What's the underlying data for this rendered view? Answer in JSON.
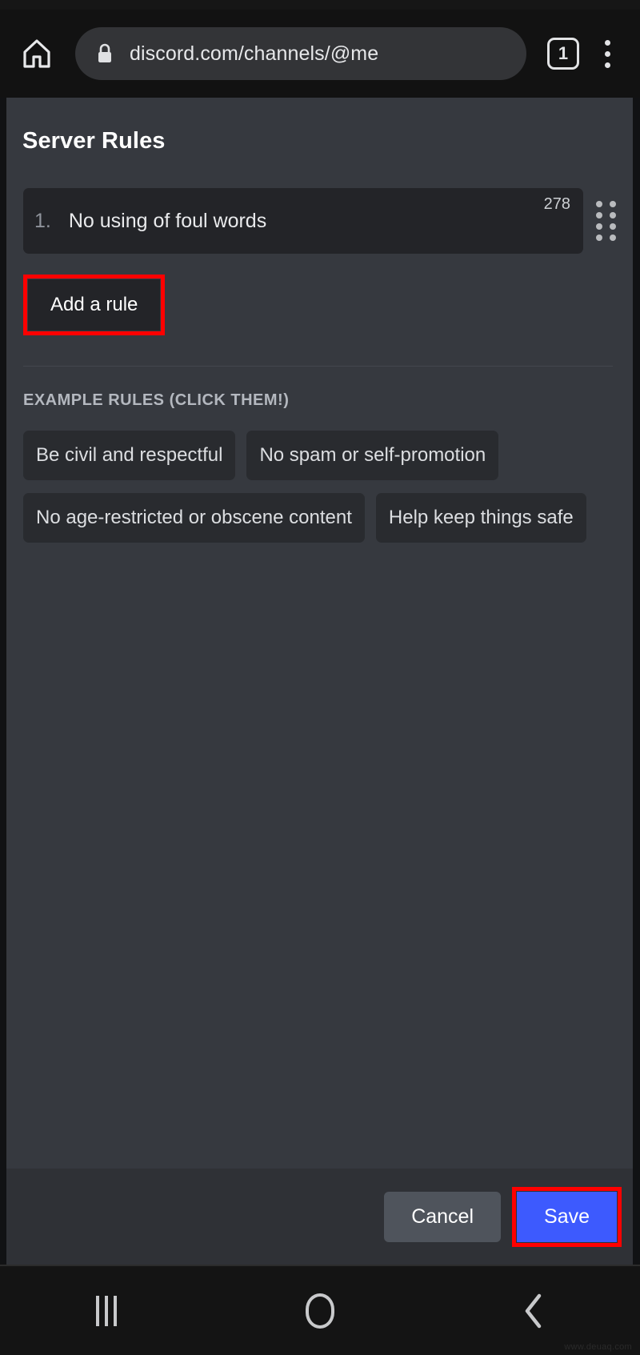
{
  "status_bar": {
    "left_text": "",
    "right_text": ""
  },
  "browser": {
    "home_icon": "home-icon",
    "lock_icon": "lock-icon",
    "url": "discord.com/channels/@me",
    "tab_count": "1",
    "menu_icon": "overflow-menu-icon"
  },
  "page": {
    "title": "Server Rules",
    "rule": {
      "number": "1.",
      "text": "No using of foul words",
      "char_count": "278",
      "drag_handle_icon": "drag-handle-icon"
    },
    "add_rule_label": "Add a rule",
    "examples_label": "EXAMPLE RULES (CLICK THEM!)",
    "example_rules": [
      "Be civil and respectful",
      "No spam or self-promotion",
      "No age-restricted or obscene content",
      "Help keep things safe"
    ]
  },
  "footer": {
    "cancel_label": "Cancel",
    "save_label": "Save"
  },
  "navbar": {
    "recents_icon": "recents-icon",
    "home_icon": "home-circle-icon",
    "back_icon": "back-chevron-icon",
    "watermark": "www.deuaq.com"
  },
  "colors": {
    "page_bg": "#36393f",
    "input_bg": "#232428",
    "chip_bg": "#292b2f",
    "footer_bg": "#2f3136",
    "accent_blue": "#3d5afe",
    "cancel_gray": "#4f545c",
    "highlight_red": "#ff0000",
    "browser_bg": "#121212",
    "navbar_bg": "#141414"
  }
}
